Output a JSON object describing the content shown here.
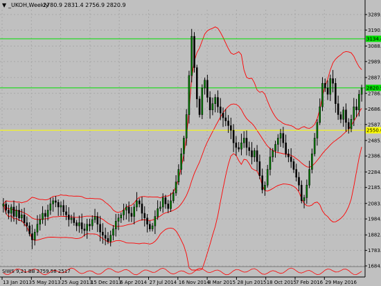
{
  "header": {
    "symbol_label": "_UKOH,Weekly",
    "ohlc_label": "2780.9 2831.4 2756.9 2820.9",
    "menu_icon": "triangle-down-icon"
  },
  "indicator": {
    "label": "SIWS 9,21 BB 2759.58 2517"
  },
  "price_axis": {
    "ticks": [
      "3289.0",
      "3190.0",
      "3088.0",
      "2989.0",
      "2887.0",
      "2786.0",
      "2686.0",
      "2587.0",
      "2485.0",
      "2386.0",
      "2284.0",
      "2185.0",
      "2083.0",
      "1984.0",
      "1882.0",
      "1783.0",
      "1684.0"
    ]
  },
  "time_axis": {
    "ticks": [
      "13 Jan 2013",
      "5 May 2013",
      "25 Aug 2013",
      "15 Dec 2013",
      "6 Apr 2014",
      "27 Jul 2014",
      "16 Nov 2014",
      "8 Mar 2015",
      "28 Jun 2015",
      "18 Oct 2015",
      "7 Feb 2016",
      "29 May 2016"
    ]
  },
  "levels": [
    {
      "name": "green-level-upper",
      "value": 3134.4,
      "label": "3134.4",
      "color": "#00e000"
    },
    {
      "name": "green-level-lower",
      "value": 2820.9,
      "label": "2820.9",
      "color": "#00e000"
    },
    {
      "name": "yellow-level",
      "value": 2550.0,
      "label": "2550.0",
      "color": "#ffff00"
    }
  ],
  "colors": {
    "background": "#c0c0c0",
    "grid": "#a8a8a8",
    "bull_candle": "#008000",
    "bear_candle": "#000000",
    "bollinger": "#ff0000",
    "indicator_line": "#ff0000"
  },
  "chart_data": {
    "type": "candlestick",
    "title": "_UKOH,Weekly",
    "ylim": [
      1684.0,
      3320.0
    ],
    "grid": true,
    "closes": [
      2080,
      2040,
      2020,
      2060,
      2000,
      2040,
      1990,
      2010,
      1960,
      1940,
      1890,
      1850,
      1900,
      1950,
      1980,
      2020,
      2000,
      2040,
      2080,
      2100,
      2090,
      2060,
      2070,
      2030,
      2010,
      1980,
      1990,
      1960,
      1940,
      1960,
      1920,
      1910,
      1950,
      1940,
      1980,
      2000,
      1950,
      1900,
      1880,
      1860,
      1840,
      1880,
      1920,
      1970,
      1990,
      2010,
      2040,
      2060,
      2020,
      2000,
      2060,
      2100,
      2080,
      2020,
      1990,
      1950,
      1920,
      1940,
      2000,
      2050,
      2060,
      2120,
      2080,
      2050,
      2100,
      2150,
      2220,
      2300,
      2400,
      2500,
      2650,
      2900,
      3150,
      2950,
      2750,
      2650,
      2820,
      2870,
      2760,
      2680,
      2720,
      2760,
      2700,
      2660,
      2630,
      2610,
      2580,
      2550,
      2470,
      2440,
      2430,
      2470,
      2500,
      2440,
      2420,
      2380,
      2420,
      2350,
      2260,
      2170,
      2200,
      2300,
      2380,
      2420,
      2460,
      2500,
      2530,
      2470,
      2400,
      2380,
      2350,
      2300,
      2250,
      2200,
      2100,
      2120,
      2200,
      2300,
      2400,
      2500,
      2600,
      2700,
      2850,
      2820,
      2780,
      2880,
      2850,
      2720,
      2650,
      2620,
      2680,
      2600,
      2560,
      2620,
      2700,
      2680,
      2780,
      2820
    ]
  }
}
